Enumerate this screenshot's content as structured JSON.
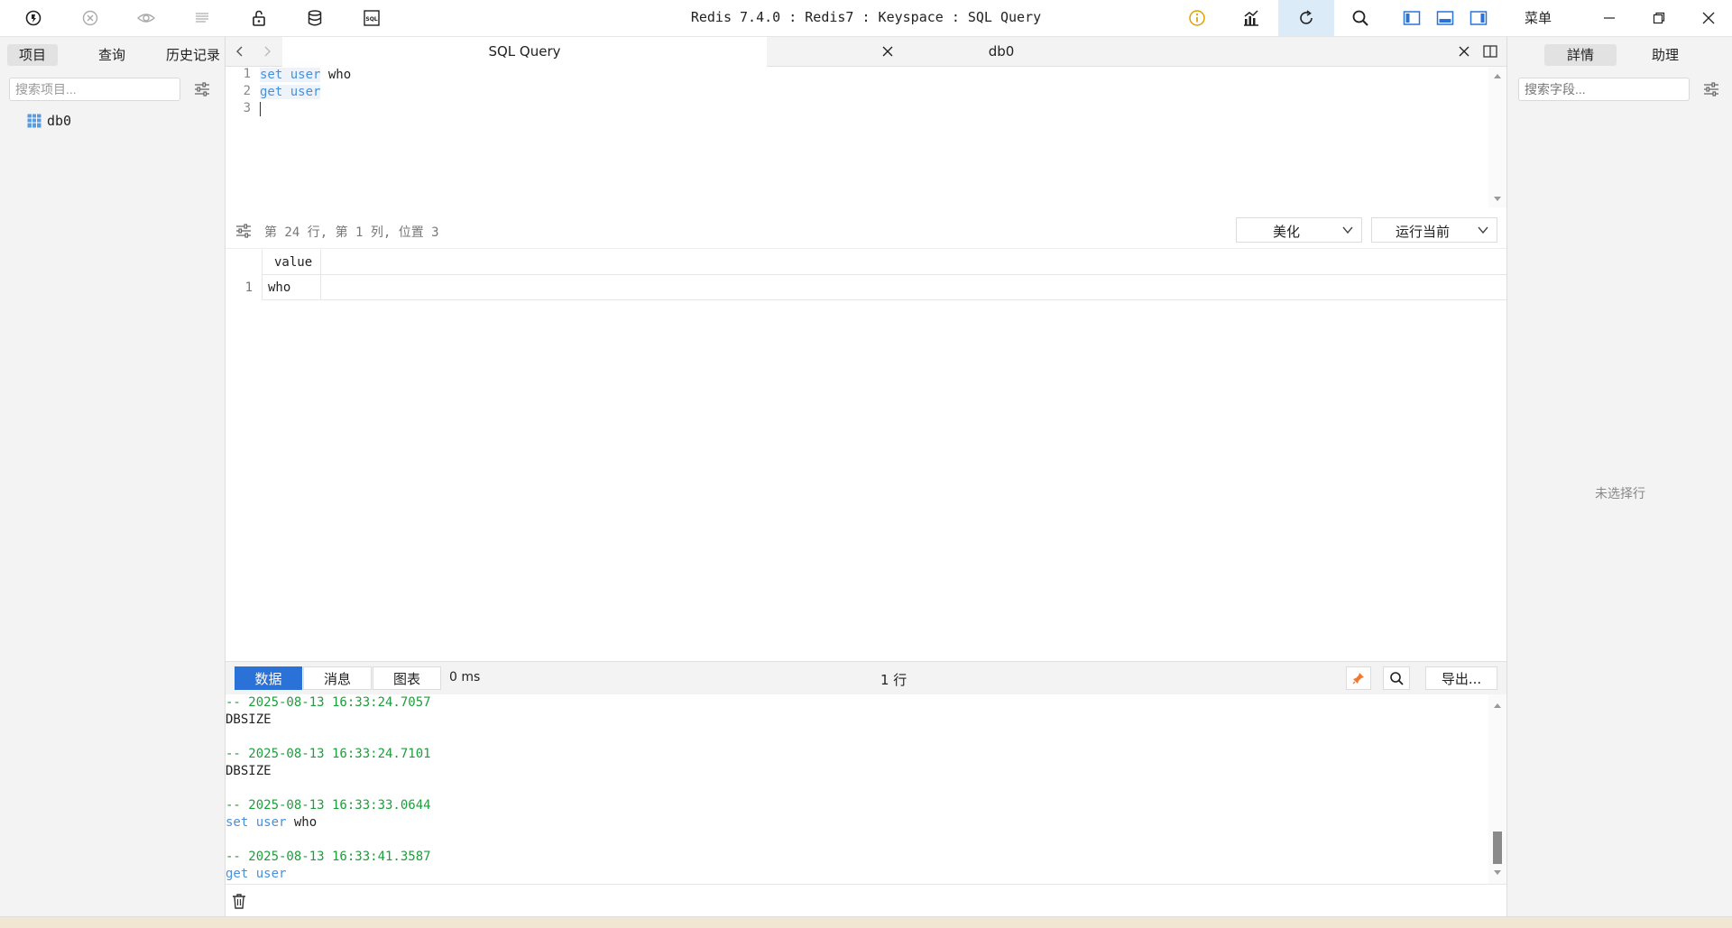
{
  "window": {
    "title": "Redis 7.4.0 : Redis7 : Keyspace : SQL Query",
    "menu_label": "菜单"
  },
  "left_panel": {
    "tabs": [
      {
        "label": "项目",
        "active": true
      },
      {
        "label": "查询",
        "active": false
      },
      {
        "label": "历史记录",
        "active": false
      }
    ],
    "search_placeholder": "搜索项目...",
    "tree": [
      {
        "label": "db0",
        "icon": "table-grid-icon"
      }
    ]
  },
  "editor": {
    "tabs": [
      {
        "label": "SQL Query",
        "active": true
      },
      {
        "label": "db0",
        "active": false
      }
    ],
    "lines": [
      {
        "no": "1",
        "cmd": "set user",
        "rest": " who"
      },
      {
        "no": "2",
        "cmd": "get user",
        "rest": ""
      },
      {
        "no": "3",
        "cmd": "",
        "rest": ""
      }
    ],
    "status": "第 24 行, 第 1 列, 位置 3",
    "beautify_label": "美化",
    "run_label": "运行当前"
  },
  "results": {
    "columns": [
      "value"
    ],
    "rows": [
      {
        "no": "1",
        "value": "who"
      }
    ]
  },
  "bottom_toolbar": {
    "tabs": [
      {
        "label": "数据",
        "active": true
      },
      {
        "label": "消息",
        "active": false
      },
      {
        "label": "图表",
        "active": false
      }
    ],
    "elapsed": "0 ms",
    "row_count": "1 行",
    "export_label": "导出..."
  },
  "log": [
    {
      "ts": "-- 2025-08-13 16:33:24.7057",
      "cmd": "",
      "text": "DBSIZE"
    },
    {
      "ts": "-- 2025-08-13 16:33:24.7101",
      "cmd": "",
      "text": "DBSIZE"
    },
    {
      "ts": "-- 2025-08-13 16:33:33.0644",
      "cmd": "set user",
      "text": " who"
    },
    {
      "ts": "-- 2025-08-13 16:33:41.3587",
      "cmd": "get user",
      "text": ""
    }
  ],
  "right_panel": {
    "tabs": [
      {
        "label": "詳情",
        "active": true
      },
      {
        "label": "助理",
        "active": false
      }
    ],
    "search_placeholder": "搜索字段...",
    "empty_note": "未选择行"
  },
  "colors": {
    "accent": "#2a72d8",
    "keyword": "#4a90d9",
    "timestamp": "#1e9d3c",
    "refresh_highlight": "#dcebf8"
  }
}
